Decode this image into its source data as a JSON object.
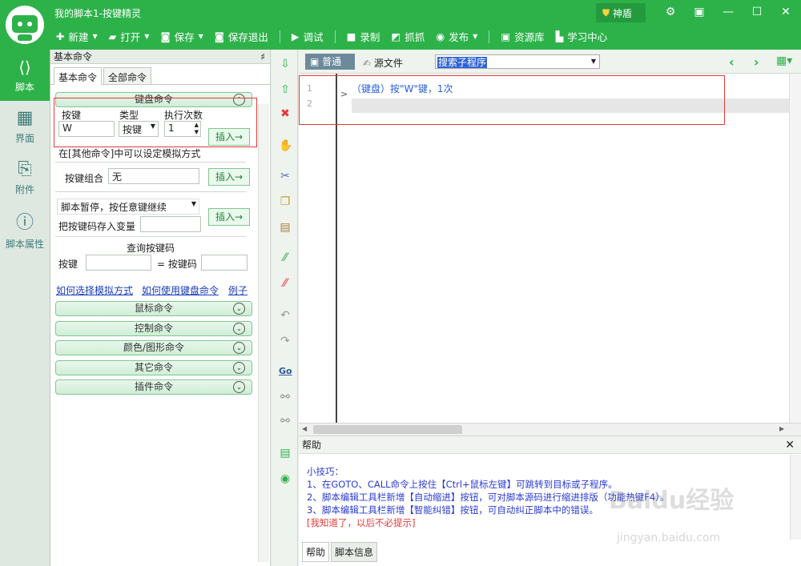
{
  "app": {
    "title": "我的脚本1-按键精灵",
    "shield_label": "神盾"
  },
  "toolbar": [
    {
      "label": "新建",
      "icon": "plus-icon",
      "dropdown": true
    },
    {
      "label": "打开",
      "icon": "folder-icon",
      "dropdown": true
    },
    {
      "label": "保存",
      "icon": "save-icon",
      "dropdown": true
    },
    {
      "label": "保存退出",
      "icon": "save-exit-icon",
      "dropdown": false
    },
    {
      "label": "调试",
      "icon": "play-icon",
      "dropdown": false
    },
    {
      "label": "录制",
      "icon": "camera-icon",
      "dropdown": false
    },
    {
      "label": "抓抓",
      "icon": "grab-icon",
      "dropdown": false
    },
    {
      "label": "发布",
      "icon": "publish-icon",
      "dropdown": true
    },
    {
      "label": "资源库",
      "icon": "resource-icon",
      "dropdown": false
    },
    {
      "label": "学习中心",
      "icon": "learn-icon",
      "dropdown": false
    }
  ],
  "leftnav": [
    {
      "label": "脚本",
      "icon": "script-icon",
      "active": true
    },
    {
      "label": "界面",
      "icon": "layout-icon",
      "active": false
    },
    {
      "label": "附件",
      "icon": "attachment-icon",
      "active": false
    },
    {
      "label": "脚本属性",
      "icon": "info-icon",
      "active": false
    }
  ],
  "panel": {
    "header": "基本命令",
    "pin": "♯",
    "tabs": [
      "基本命令",
      "全部命令"
    ],
    "keyboard": {
      "group_label": "键盘命令",
      "col_key": "按键",
      "col_type": "类型",
      "col_count": "执行次数",
      "key_value": "W",
      "type_value": "按键",
      "count_value": "1",
      "insert": "插入→",
      "note": "在[其他命令]中可以设定模拟方式",
      "combo_label": "按键组合",
      "combo_value": "无",
      "pause_option": "脚本暂停，按任意键继续",
      "store_label": "把按键码存入变量",
      "query_title": "查询按键码",
      "query_key": "按键",
      "query_code": "= 按键码"
    },
    "links": [
      "如何选择模拟方式",
      "如何使用键盘命令",
      "例子"
    ],
    "groups": [
      "鼠标命令",
      "控制命令",
      "颜色/图形命令",
      "其它命令",
      "插件命令"
    ]
  },
  "editor": {
    "mode_normal": "普通",
    "mode_source": "源文件",
    "sub_search": "搜索子程序",
    "lines": [
      "1",
      "2"
    ],
    "code_line": "（键盘）按\"W\"键，1次"
  },
  "help": {
    "title": "帮助",
    "tip_title": "小技巧：",
    "tips": [
      "1、在GOTO、CALL命令上按住【Ctrl+鼠标左键】可跳转到目标或子程序。",
      "2、脚本编辑工具栏新增【自动缩进】按钮，可对脚本源码进行缩进排版（功能热键F4）。",
      "3、脚本编辑工具栏新增【智能纠错】按钮，可自动纠正脚本中的错误。"
    ],
    "dismiss": "[我知道了，以后不必提示]",
    "tabs": [
      "帮助",
      "脚本信息"
    ]
  },
  "watermark": {
    "main": "Baidu经验",
    "sub": "jingyan.baidu.com"
  },
  "colors": {
    "brand": "#2db24a",
    "link": "#1a3db8",
    "tip": "#2a3bd1",
    "alert": "#e03a3a"
  }
}
